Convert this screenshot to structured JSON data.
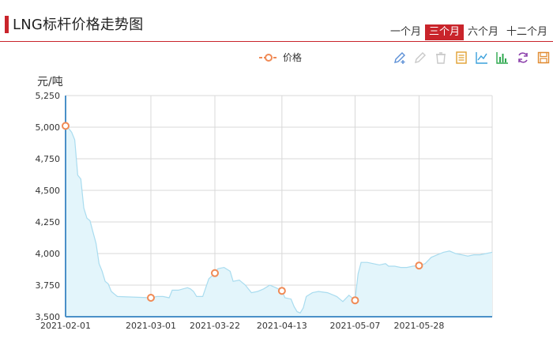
{
  "header": {
    "title": "LNG标杆价格走势图",
    "tabs": [
      {
        "label": "一个月",
        "active": false
      },
      {
        "label": "三个月",
        "active": true
      },
      {
        "label": "六个月",
        "active": false
      },
      {
        "label": "十二个月",
        "active": false
      }
    ]
  },
  "toolbox": {
    "icons": [
      "zoom-pen-icon",
      "zoom-reset-pen-icon",
      "restore-eraser-icon",
      "data-view-icon",
      "line-chart-icon",
      "bar-chart-icon",
      "refresh-icon",
      "save-image-icon"
    ]
  },
  "colors": {
    "accent": "#c9242b",
    "line": "#a9dcef",
    "area": "#e3f5fb",
    "marker": "#f08a55",
    "axis": "#4a90c8"
  },
  "chart_data": {
    "type": "area",
    "legend": [
      "价格"
    ],
    "legend_position": "top-center",
    "unit_label": "元/吨",
    "ylim": [
      3500,
      5250
    ],
    "y_ticks": [
      "5,250",
      "5,000",
      "4,750",
      "4,500",
      "4,250",
      "4,000",
      "3,750",
      "3,500"
    ],
    "x_tick_labels": [
      "2021-02-01",
      "2021-03-01",
      "2021-03-22",
      "2021-04-13",
      "2021-05-07",
      "2021-05-28"
    ],
    "grid": true,
    "series": [
      {
        "name": "价格",
        "points": [
          [
            "2021-02-01",
            5010
          ],
          [
            "2021-02-02",
            4990
          ],
          [
            "2021-02-03",
            4960
          ],
          [
            "2021-02-04",
            4900
          ],
          [
            "2021-02-05",
            4620
          ],
          [
            "2021-02-06",
            4590
          ],
          [
            "2021-02-07",
            4360
          ],
          [
            "2021-02-08",
            4280
          ],
          [
            "2021-02-09",
            4260
          ],
          [
            "2021-02-10",
            4170
          ],
          [
            "2021-02-11",
            4080
          ],
          [
            "2021-02-12",
            3920
          ],
          [
            "2021-02-13",
            3860
          ],
          [
            "2021-02-14",
            3780
          ],
          [
            "2021-02-15",
            3760
          ],
          [
            "2021-02-16",
            3700
          ],
          [
            "2021-02-17",
            3680
          ],
          [
            "2021-02-18",
            3660
          ],
          [
            "2021-03-01",
            3650
          ],
          [
            "2021-03-03",
            3660
          ],
          [
            "2021-03-05",
            3660
          ],
          [
            "2021-03-07",
            3650
          ],
          [
            "2021-03-08",
            3710
          ],
          [
            "2021-03-10",
            3710
          ],
          [
            "2021-03-13",
            3730
          ],
          [
            "2021-03-14",
            3720
          ],
          [
            "2021-03-15",
            3700
          ],
          [
            "2021-03-16",
            3660
          ],
          [
            "2021-03-18",
            3660
          ],
          [
            "2021-03-20",
            3800
          ],
          [
            "2021-03-22",
            3845
          ],
          [
            "2021-03-23",
            3880
          ],
          [
            "2021-03-25",
            3890
          ],
          [
            "2021-03-27",
            3860
          ],
          [
            "2021-03-28",
            3780
          ],
          [
            "2021-03-30",
            3790
          ],
          [
            "2021-04-01",
            3750
          ],
          [
            "2021-04-03",
            3690
          ],
          [
            "2021-04-05",
            3700
          ],
          [
            "2021-04-07",
            3720
          ],
          [
            "2021-04-09",
            3750
          ],
          [
            "2021-04-11",
            3730
          ],
          [
            "2021-04-13",
            3705
          ],
          [
            "2021-04-14",
            3650
          ],
          [
            "2021-04-16",
            3640
          ],
          [
            "2021-04-17",
            3580
          ],
          [
            "2021-04-18",
            3540
          ],
          [
            "2021-04-19",
            3530
          ],
          [
            "2021-04-20",
            3570
          ],
          [
            "2021-04-21",
            3660
          ],
          [
            "2021-04-23",
            3690
          ],
          [
            "2021-04-25",
            3700
          ],
          [
            "2021-04-28",
            3690
          ],
          [
            "2021-05-01",
            3660
          ],
          [
            "2021-05-03",
            3620
          ],
          [
            "2021-05-05",
            3670
          ],
          [
            "2021-05-07",
            3630
          ],
          [
            "2021-05-08",
            3840
          ],
          [
            "2021-05-09",
            3930
          ],
          [
            "2021-05-11",
            3930
          ],
          [
            "2021-05-13",
            3920
          ],
          [
            "2021-05-15",
            3910
          ],
          [
            "2021-05-17",
            3920
          ],
          [
            "2021-05-18",
            3900
          ],
          [
            "2021-05-20",
            3900
          ],
          [
            "2021-05-22",
            3890
          ],
          [
            "2021-05-24",
            3890
          ],
          [
            "2021-05-26",
            3900
          ],
          [
            "2021-05-28",
            3905
          ],
          [
            "2021-05-30",
            3920
          ],
          [
            "2021-06-01",
            3970
          ],
          [
            "2021-06-03",
            3990
          ],
          [
            "2021-06-05",
            4010
          ],
          [
            "2021-06-07",
            4020
          ],
          [
            "2021-06-09",
            4000
          ],
          [
            "2021-06-11",
            3990
          ],
          [
            "2021-06-13",
            3980
          ],
          [
            "2021-06-15",
            3990
          ],
          [
            "2021-06-17",
            3990
          ],
          [
            "2021-06-19",
            4000
          ],
          [
            "2021-06-21",
            4010
          ]
        ]
      }
    ],
    "markers": [
      [
        "2021-02-01",
        5010
      ],
      [
        "2021-03-01",
        3650
      ],
      [
        "2021-03-22",
        3845
      ],
      [
        "2021-04-13",
        3705
      ],
      [
        "2021-05-07",
        3630
      ],
      [
        "2021-05-28",
        3905
      ]
    ]
  }
}
